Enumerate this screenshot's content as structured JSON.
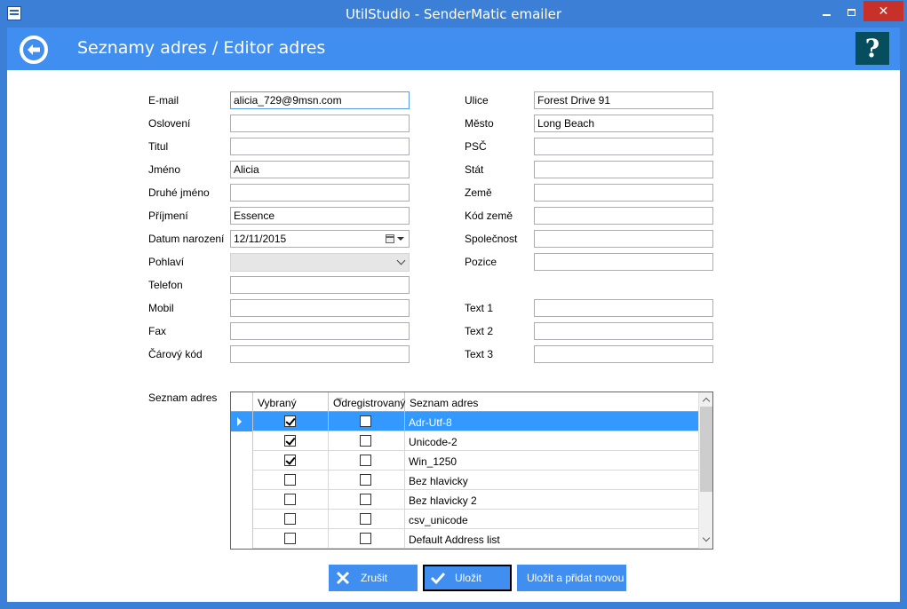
{
  "window": {
    "title": "UtilStudio - SenderMatic emailer",
    "min_icon": "minimize-icon",
    "max_icon": "maximize-icon",
    "close_glyph": "✕"
  },
  "header": {
    "title": "Seznamy adres / Editor adres",
    "help_label": "?"
  },
  "form": {
    "left": [
      {
        "label": "E-mail",
        "value": "alicia_729@9msn.com",
        "type": "text"
      },
      {
        "label": "Oslovení",
        "value": "",
        "type": "text"
      },
      {
        "label": "Titul",
        "value": "",
        "type": "text"
      },
      {
        "label": "Jméno",
        "value": "Alicia",
        "type": "text"
      },
      {
        "label": "Druhé jméno",
        "value": "",
        "type": "text"
      },
      {
        "label": "Příjmení",
        "value": "Essence",
        "type": "text"
      },
      {
        "label": "Datum narození",
        "value": "12/11/2015",
        "type": "date"
      },
      {
        "label": "Pohlaví",
        "value": "",
        "type": "combo"
      },
      {
        "label": "Telefon",
        "value": "",
        "type": "text"
      },
      {
        "label": "Mobil",
        "value": "",
        "type": "text"
      },
      {
        "label": "Fax",
        "value": "",
        "type": "text"
      },
      {
        "label": "Čárový kód",
        "value": "",
        "type": "text"
      }
    ],
    "right": [
      {
        "label": "Ulice",
        "value": "Forest Drive 91"
      },
      {
        "label": "Město",
        "value": "Long Beach"
      },
      {
        "label": "PSČ",
        "value": ""
      },
      {
        "label": "Stát",
        "value": ""
      },
      {
        "label": "Země",
        "value": ""
      },
      {
        "label": "Kód země",
        "value": ""
      },
      {
        "label": "Společnost",
        "value": ""
      },
      {
        "label": "Pozice",
        "value": ""
      }
    ],
    "texts": [
      {
        "label": "Text 1",
        "value": ""
      },
      {
        "label": "Text 2",
        "value": ""
      },
      {
        "label": "Text 3",
        "value": ""
      }
    ]
  },
  "lists": {
    "label": "Seznam adres",
    "columns": [
      "Vybraný",
      "Odregistrovaný",
      "Seznam adres"
    ],
    "rows": [
      {
        "selected": true,
        "unsubscribed": false,
        "name": "Adr-Utf-8",
        "current": true
      },
      {
        "selected": true,
        "unsubscribed": false,
        "name": "Unicode-2",
        "current": false
      },
      {
        "selected": true,
        "unsubscribed": false,
        "name": "Win_1250",
        "current": false
      },
      {
        "selected": false,
        "unsubscribed": false,
        "name": "Bez hlavicky",
        "current": false
      },
      {
        "selected": false,
        "unsubscribed": false,
        "name": "Bez hlavicky 2",
        "current": false
      },
      {
        "selected": false,
        "unsubscribed": false,
        "name": "csv_unicode",
        "current": false
      },
      {
        "selected": false,
        "unsubscribed": false,
        "name": "Default Address list",
        "current": false
      }
    ]
  },
  "buttons": {
    "cancel": "Zrušit",
    "save": "Uložit",
    "save_new": "Uložit a přidat novou"
  },
  "colors": {
    "accent": "#3f8ef0",
    "selection": "#3399ff",
    "help_bg": "#064e5e",
    "close": "#c7312a"
  }
}
